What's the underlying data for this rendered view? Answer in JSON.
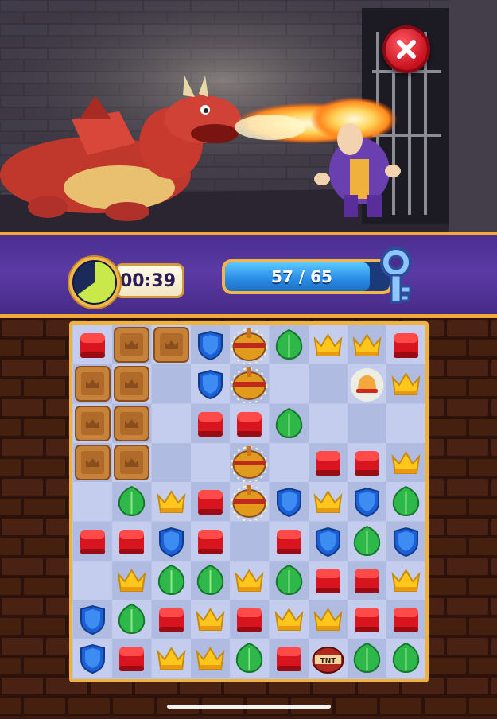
{
  "hud": {
    "timer": "00:39",
    "timer_remaining_fraction": 0.65,
    "progress_text": "57 / 65",
    "progress_current": 57,
    "progress_total": 65
  },
  "icons": {
    "close": "close-icon",
    "key": "key-icon",
    "timer": "stopwatch-icon"
  },
  "colors": {
    "hud_purple": "#5b3aa6",
    "gold_border": "#f0b23c",
    "close_red": "#d9192a",
    "progress_blue": "#2a8ee8"
  },
  "board": {
    "cols": 9,
    "rows": 9,
    "grid": [
      [
        "red",
        "crate",
        "crate",
        "blue",
        "barrel",
        "leaf",
        "crown",
        "crown",
        "red"
      ],
      [
        "crate",
        "crate",
        "empty",
        "blue",
        "barrel",
        "empty",
        "empty",
        "bell",
        "crown"
      ],
      [
        "crate",
        "crate",
        "empty",
        "red",
        "red",
        "leaf",
        "empty",
        "empty",
        "empty"
      ],
      [
        "crate",
        "crate",
        "empty",
        "empty",
        "barrel",
        "empty",
        "red",
        "red",
        "crown"
      ],
      [
        "empty",
        "leaf",
        "crown",
        "red",
        "barrel",
        "blue",
        "crown",
        "blue",
        "leaf"
      ],
      [
        "red",
        "red",
        "blue",
        "red",
        "empty",
        "red",
        "blue",
        "leaf",
        "blue"
      ],
      [
        "empty",
        "crown",
        "leaf",
        "leaf",
        "crown",
        "leaf",
        "red",
        "red",
        "crown"
      ],
      [
        "blue",
        "leaf",
        "red",
        "crown",
        "red",
        "crown",
        "crown",
        "red",
        "red"
      ],
      [
        "blue",
        "red",
        "crown",
        "crown",
        "leaf",
        "red",
        "tnt",
        "leaf",
        "leaf"
      ]
    ]
  },
  "tnt_label": "TNT"
}
